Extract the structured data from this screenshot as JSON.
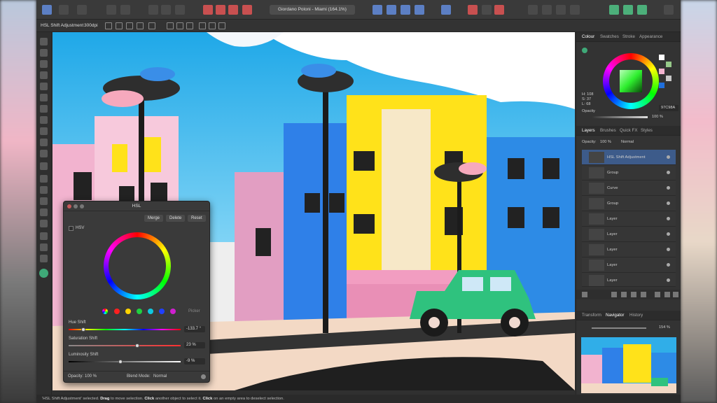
{
  "document_title": "Giordano Poloni - Miami (164.1%)",
  "context_toolbar": {
    "tool_label": "HSL Shift Adjustment",
    "dpi": "300dpi"
  },
  "hsl_dialog": {
    "title": "HSL",
    "buttons": {
      "merge": "Merge",
      "delete": "Delete",
      "reset": "Reset"
    },
    "hsv_label": "HSV",
    "picker_label": "Picker",
    "swatch_colors": [
      "#ff2020",
      "#ffd400",
      "#20d040",
      "#10c8e0",
      "#2040ff",
      "#d020d0"
    ],
    "hue_shift": {
      "label": "Hue Shift",
      "value": "-133.7 °",
      "level": 0.13
    },
    "saturation_shift": {
      "label": "Saturation Shift",
      "value": "23 %",
      "level": 0.61
    },
    "luminosity_shift": {
      "label": "Luminosity Shift",
      "value": "-9 %",
      "level": 0.46
    },
    "opacity_label": "Opacity:",
    "opacity_value": "100 %",
    "blend_label": "Blend Mode:",
    "blend_value": "Normal"
  },
  "colour_panel": {
    "tabs": [
      "Colour",
      "Swatches",
      "Stroke",
      "Appearance"
    ],
    "h": "H: 108",
    "s": "S: 37",
    "l": "L: 68",
    "hex": "97C98A",
    "opacity_label": "Opacity",
    "opacity_value": "100 %"
  },
  "layers_panel": {
    "tabs": [
      "Layers",
      "Brushes",
      "Quick FX",
      "Styles"
    ],
    "opacity_label": "Opacity:",
    "opacity_value": "100 %",
    "blend_value": "Normal",
    "layers": [
      {
        "name": "HSL Shift Adjustment"
      },
      {
        "name": "Group"
      },
      {
        "name": "Curve"
      },
      {
        "name": "Group"
      },
      {
        "name": "Layer"
      },
      {
        "name": "Layer"
      },
      {
        "name": "Layer"
      },
      {
        "name": "Layer"
      },
      {
        "name": "Layer"
      }
    ]
  },
  "navigator_panel": {
    "tabs": [
      "Transform",
      "Navigator",
      "History"
    ],
    "zoom": "154 %"
  },
  "status_bar": {
    "p1": "'HSL Shift Adjustment' selected. ",
    "b1": "Drag",
    "p2": " to move selection. ",
    "b2": "Click",
    "p3": " another object to select it. ",
    "b3": "Click",
    "p4": " on an empty area to deselect selection."
  },
  "colors": {
    "accent": "#3d5b8a",
    "active_tool": "#3fa978"
  }
}
